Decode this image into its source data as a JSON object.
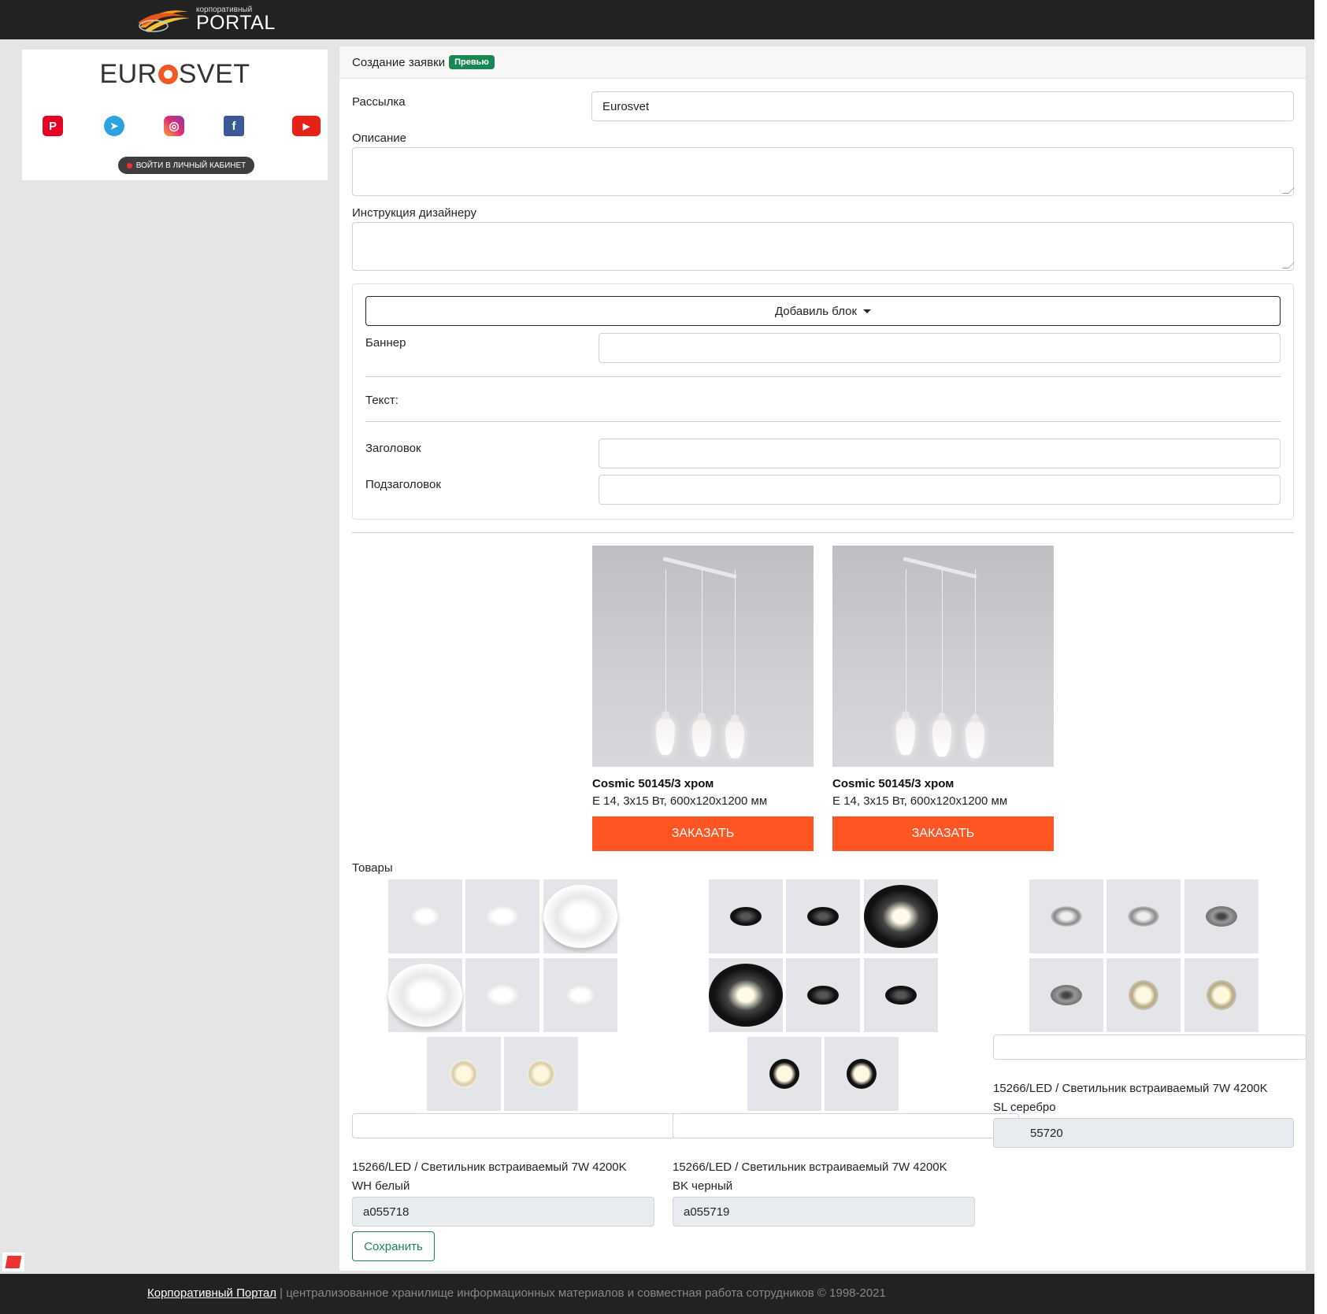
{
  "header": {
    "logo_small": "корпоративный",
    "logo_big": "PORTAL"
  },
  "sidebar": {
    "brand_pre": "EUR",
    "brand_post": "SVET",
    "socials": [
      "pinterest-icon",
      "telegram-icon",
      "instagram-icon",
      "facebook-icon",
      "youtube-icon"
    ],
    "cabinet_button": "ВОЙТИ В ЛИЧНЫЙ КАБИНЕТ"
  },
  "card": {
    "title": "Создание заявки",
    "badge": "Превью"
  },
  "form": {
    "mailing_label": "Рассылка",
    "mailing_value": "Eurosvet",
    "description_label": "Описание",
    "designer_label": "Инструкция дизайнеру",
    "add_block": "Добавиль блок",
    "banner_label": "Баннер",
    "text_label": "Текст:",
    "heading_label": "Заголовок",
    "subheading_label": "Подзаголовок"
  },
  "products": [
    {
      "name": "Cosmic 50145/3 хром",
      "spec": "E 14, 3x15 Вт, 600x120x1200 мм",
      "button": "ЗАКАЗАТЬ"
    },
    {
      "name": "Cosmic 50145/3 хром",
      "spec": "E 14, 3x15 Вт, 600x120x1200 мм",
      "button": "ЗАКАЗАТЬ"
    }
  ],
  "goods": {
    "label": "Товары",
    "items": [
      {
        "title_line1": "15266/LED / Светильник встраиваемый 7W 4200K",
        "title_line2": "WH белый",
        "code": "a055718",
        "color": "#ffffff"
      },
      {
        "title_line1": "15266/LED / Светильник встраиваемый 7W 4200K",
        "title_line2": "BK черный",
        "code": "a055719",
        "color": "#111111"
      },
      {
        "title_line1": "15266/LED / Светильник встраиваемый 7W 4200K",
        "title_line2": "SL серебро",
        "code": "55720",
        "color": "#b8b8b8"
      }
    ]
  },
  "save_button": "Сохранить",
  "footer": {
    "link": "Корпоративный Портал",
    "sep": " | ",
    "text": "централизованное хранилище информационных материалов и совместная работа сотрудников © 1998-2021"
  },
  "colors": {
    "accent_order": "#ff5523",
    "success": "#198754",
    "topbar": "#222222"
  }
}
